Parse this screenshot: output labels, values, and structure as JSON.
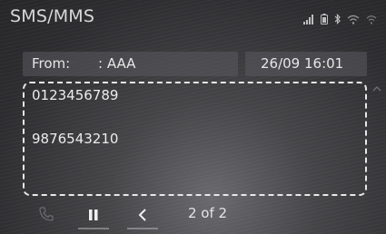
{
  "header": {
    "title": "SMS/MMS",
    "icons": [
      "signal-strength-icon",
      "phone-battery-icon",
      "bluetooth-icon",
      "wifi-icon",
      "wifi-secondary-icon"
    ]
  },
  "message": {
    "from_label": "From:",
    "from_value": ": AAA",
    "datetime": "26/09 16:01",
    "body_lines": [
      "0123456789",
      "9876543210"
    ]
  },
  "controls": {
    "icons": [
      "call-icon",
      "pause-icon",
      "back-icon"
    ],
    "page_indicator": "2 of 2"
  },
  "colors": {
    "text": "#e6e6e6",
    "dashed_border": "#e8e8e8",
    "field_background": "#5a5a5e"
  }
}
